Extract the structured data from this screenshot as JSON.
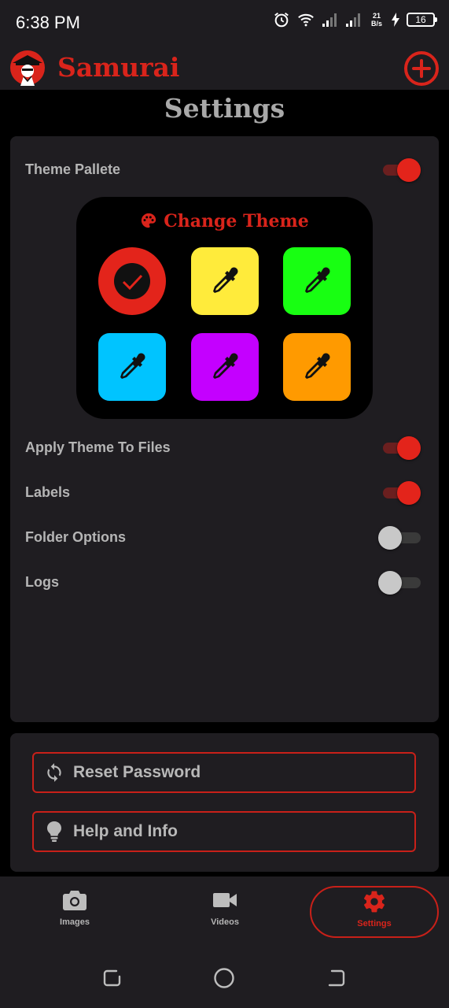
{
  "status_bar": {
    "time": "6:38 PM",
    "net_speed_value": "21",
    "net_speed_unit": "B/s",
    "battery": "16"
  },
  "app_bar": {
    "title": "Samurai"
  },
  "page": {
    "title": "Settings"
  },
  "settings": {
    "theme_pallete": {
      "label": "Theme Pallete",
      "enabled": true
    },
    "theme_panel": {
      "heading": "Change Theme",
      "selected_color": "#e3241b",
      "swatches": [
        "#e3241b",
        "#ffeb3b",
        "#18ff12",
        "#00c4ff",
        "#c400ff",
        "#ff9a00"
      ]
    },
    "apply_theme_to_files": {
      "label": "Apply Theme To Files",
      "enabled": true
    },
    "labels": {
      "label": "Labels",
      "enabled": true
    },
    "folder_options": {
      "label": "Folder Options",
      "enabled": false
    },
    "logs": {
      "label": "Logs",
      "enabled": false
    }
  },
  "actions": {
    "reset_password": {
      "label": "Reset Password",
      "icon": "sync-icon"
    },
    "help_and_info": {
      "label": "Help and Info",
      "icon": "lightbulb-icon"
    }
  },
  "bottom_nav": {
    "items": [
      {
        "label": "Images",
        "icon": "camera-icon",
        "active": false
      },
      {
        "label": "Videos",
        "icon": "video-camera-icon",
        "active": false
      },
      {
        "label": "Settings",
        "icon": "gear-icon",
        "active": true
      }
    ]
  },
  "colors": {
    "accent": "#d9241b",
    "background": "#000000",
    "card": "#1f1d21"
  }
}
